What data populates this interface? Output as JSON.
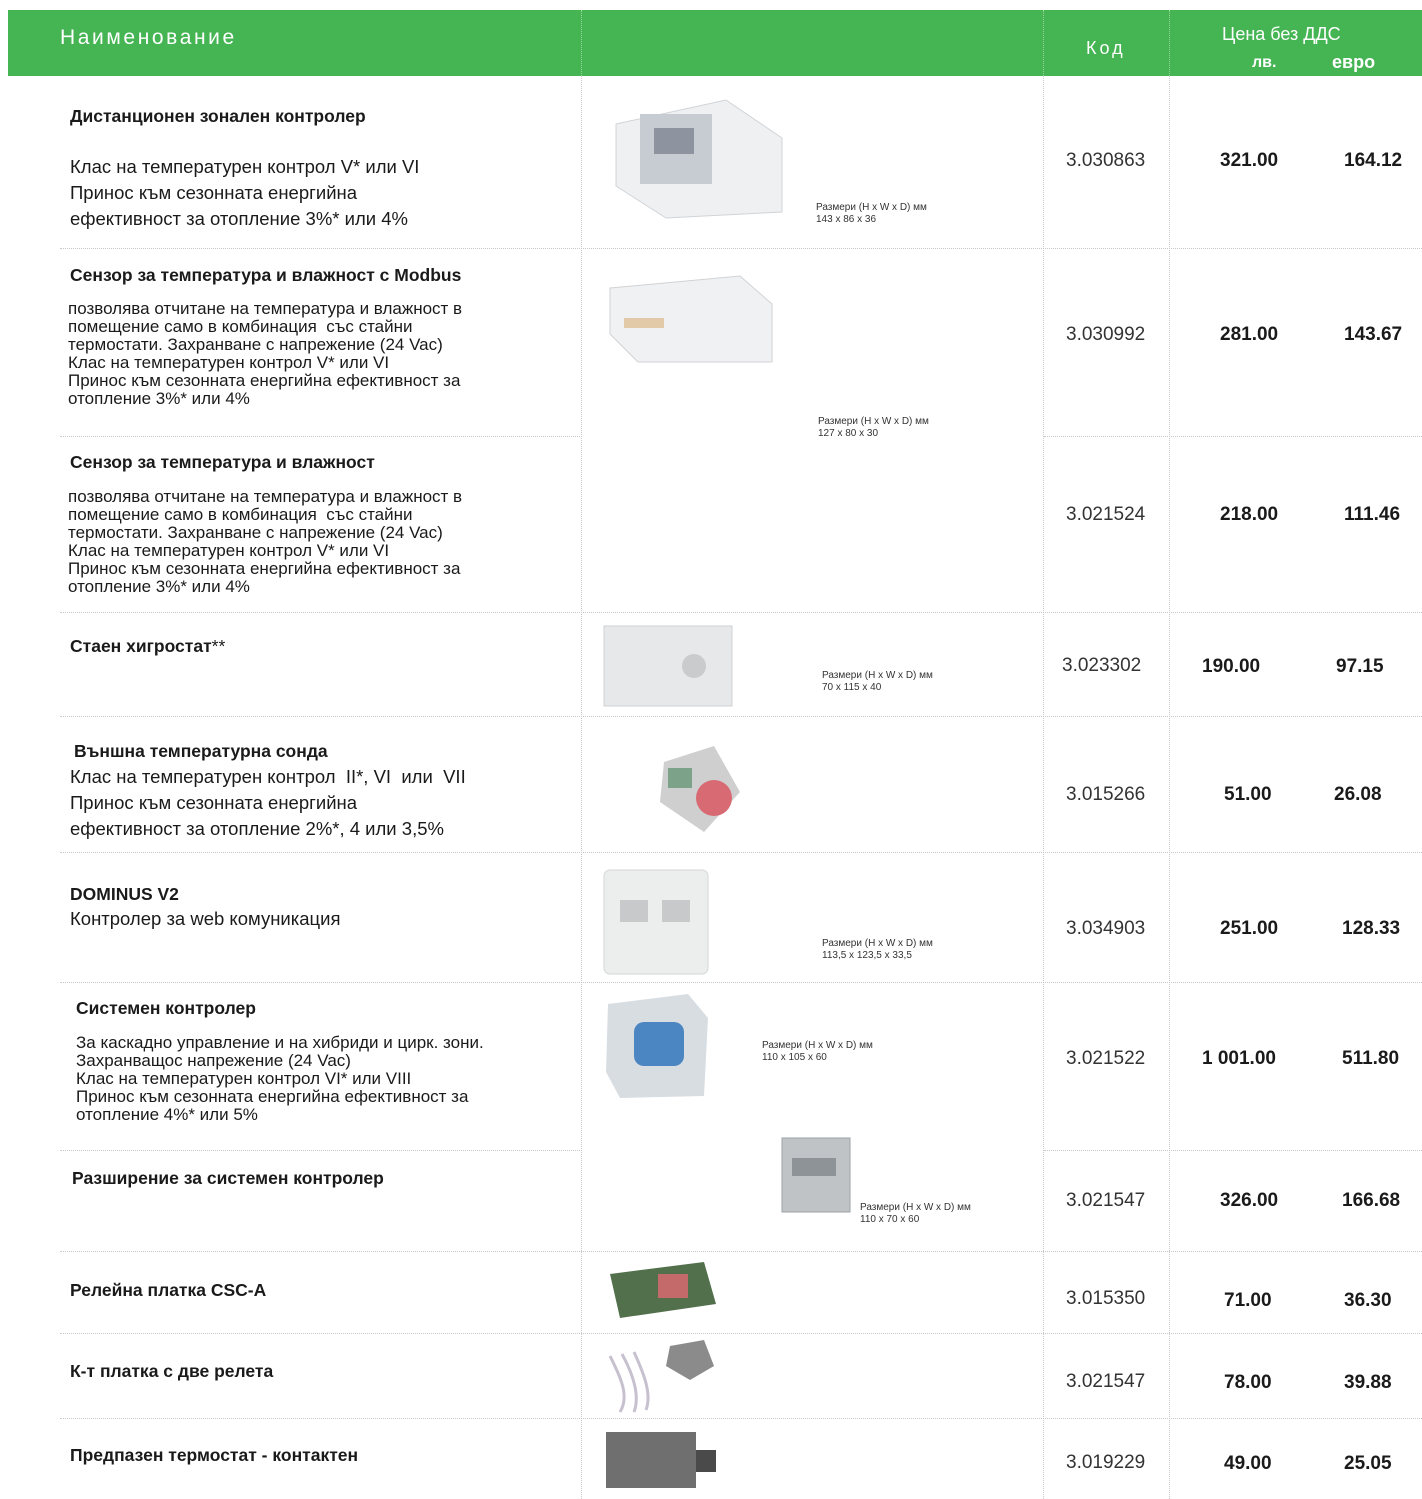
{
  "header": {
    "name": "Наименование",
    "code": "Код",
    "price": "Цена без ДДС",
    "lv": "лв.",
    "eur": "евро"
  },
  "rows": [
    {
      "title": "Дистанционен зонален контролер",
      "desc": "Клас на температурен контрол V* или VI\nПринос към сезонната енергийна\nефективност за отопление 3%* или 4%",
      "dims": "Размери (H x W x D) мм\n143 x 86 x 36",
      "code": "3.030863",
      "lv": "321.00",
      "eur": "164.12"
    },
    {
      "title": "Сензор за температура и влажност с Modbus",
      "desc": "позволява отчитане на температура и влажност в\nпомещение само в комбинация  със стайни\nтермостати. Захранване с напрежение (24 Vac)\nКлас на температурен контрол V* или VI\nПринос към сезонната енергийна ефективност за\nотопление 3%* или 4%",
      "dims": "Размери (H x W x D) мм\n127 x 80 x 30",
      "code": "3.030992",
      "lv": "281.00",
      "eur": "143.67"
    },
    {
      "title": "Сензор за температура и влажност",
      "desc": "позволява отчитане на температура и влажност в\nпомещение само в комбинация  със стайни\nтермостати. Захранване с напрежение (24 Vac)\nКлас на температурен контрол V* или VI\nПринос към сезонната енергийна ефективност за\nотопление 3%* или 4%",
      "code": "3.021524",
      "lv": "218.00",
      "eur": "111.46"
    },
    {
      "title": "Стаен хигростат",
      "title_suffix": "**",
      "dims": "Размери (H x W x D) мм\n70 x 115 x 40",
      "code": "3.023302",
      "lv": "190.00",
      "eur": "97.15"
    },
    {
      "title": "Външна температурна сонда",
      "desc": "Клас на температурен контрол  II*, VI  или  VII\nПринос към сезонната енергийна\nефективност за отопление 2%*, 4 или 3,5%",
      "code": "3.015266",
      "lv": "51.00",
      "eur": "26.08"
    },
    {
      "title": "DOMINUS V2",
      "desc": "Контролер за web комуникация",
      "dims": "Размери (H x W x D) мм\n113,5 x 123,5 x 33,5",
      "code": "3.034903",
      "lv": "251.00",
      "eur": "128.33"
    },
    {
      "title": "Системен контролер",
      "desc": "За каскадно управление и на хибриди и цирк. зони.\nЗахранващос напрежение (24 Vac)\nКлас на температурен контрол VI* или VIII\nПринос към сезонната енергийна ефективност за\nотопление 4%* или 5%",
      "dims": "Размери (H x W x D) мм\n110 x 105 x 60",
      "code": "3.021522",
      "lv": "1 001.00",
      "eur": "511.80"
    },
    {
      "title": "Разширение за системен контролер",
      "dims": "Размери (H x W x D) мм\n110 x 70 x 60",
      "code": "3.021547",
      "lv": "326.00",
      "eur": "166.68"
    },
    {
      "title": "Релейна платка CSC-A",
      "code": "3.015350",
      "lv": "71.00",
      "eur": "36.30"
    },
    {
      "title": "К-т платка с две релета",
      "code": "3.021547",
      "lv": "78.00",
      "eur": "39.88"
    },
    {
      "title": "Предпазен термостат - контактен",
      "code": "3.019229",
      "lv": "49.00",
      "eur": "25.05"
    }
  ],
  "colors": {
    "header_bg": "#45b553",
    "header_text": "#ffffff"
  }
}
